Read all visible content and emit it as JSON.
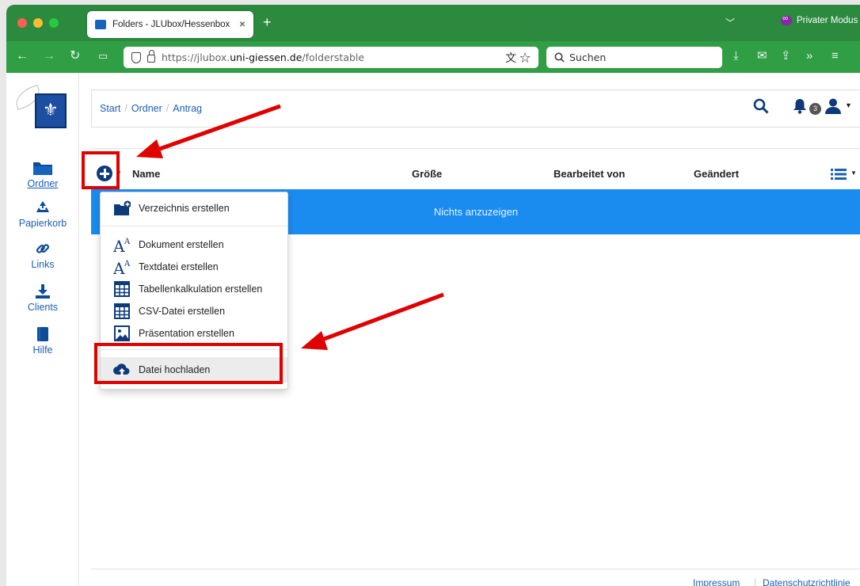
{
  "browser": {
    "tab_title": "Folders - JLUbox/Hessenbox",
    "tab_close": "×",
    "new_tab": "+",
    "private_label": "Privater Modus",
    "url_prefix": "https://jlubox.",
    "url_domain": "uni-giessen.de",
    "url_path": "/folderstable",
    "search_placeholder": "Suchen"
  },
  "sidebar": {
    "items": [
      {
        "label": "Ordner",
        "icon": "folder-icon"
      },
      {
        "label": "Papierkorb",
        "icon": "recycle-icon"
      },
      {
        "label": "Links",
        "icon": "link-icon"
      },
      {
        "label": "Clients",
        "icon": "download-icon"
      },
      {
        "label": "Hilfe",
        "icon": "book-icon"
      }
    ]
  },
  "breadcrumb": [
    "Start",
    "Ordner",
    "Antrag"
  ],
  "notifications": {
    "count": "3"
  },
  "table": {
    "columns": [
      "Name",
      "Größe",
      "Bearbeitet von",
      "Geändert"
    ],
    "empty_text": "Nichts anzuzeigen"
  },
  "menu": {
    "items": [
      {
        "label": "Verzeichnis erstellen",
        "icon": "folder-plus-icon"
      },
      {
        "label": "Dokument erstellen",
        "icon": "font-icon"
      },
      {
        "label": "Textdatei erstellen",
        "icon": "font-icon"
      },
      {
        "label": "Tabellenkalkulation erstellen",
        "icon": "table-icon"
      },
      {
        "label": "CSV-Datei erstellen",
        "icon": "table-icon"
      },
      {
        "label": "Präsentation erstellen",
        "icon": "image-icon"
      },
      {
        "label": "Datei hochladen",
        "icon": "cloud-upload-icon"
      }
    ]
  },
  "footer": {
    "impressum": "Impressum",
    "datenschutz": "Datenschutzrichtlinie"
  },
  "colors": {
    "titlebar": "#2b8a3e",
    "navbar": "#2f9e44",
    "accent": "#1a8cf0",
    "link": "#1a5fb4",
    "annotation": "#e00000"
  }
}
